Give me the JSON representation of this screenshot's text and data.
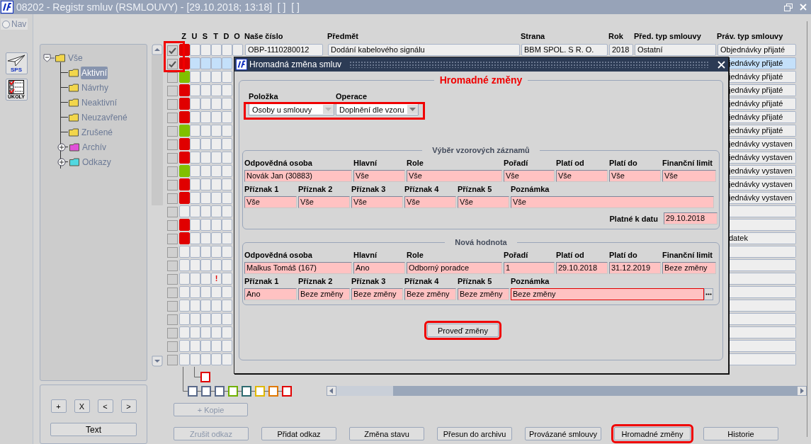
{
  "window": {
    "title": "08202 - Registr smluv (RSMLOUVY) - [29.10.2018; 13:18]  [ ]  [ ]"
  },
  "nav": {
    "label": "Nav",
    "selected": false
  },
  "launchers": [
    {
      "label": "SPS",
      "kind": "plane"
    },
    {
      "label": "ÚKOLY",
      "kind": "checklist"
    }
  ],
  "tree": [
    {
      "label": "Vše",
      "expanded": true,
      "selected": false,
      "color": "#f2d64b",
      "children": [
        {
          "label": "Aktivní",
          "selected": true,
          "color": "#f2d64b"
        },
        {
          "label": "Návrhy",
          "selected": false,
          "color": "#f2d64b"
        },
        {
          "label": "Neaktivní",
          "selected": false,
          "color": "#f2d64b"
        },
        {
          "label": "Neuzavřené",
          "selected": false,
          "color": "#f2d64b"
        },
        {
          "label": "Zrušené",
          "selected": false,
          "color": "#f2d64b"
        },
        {
          "label": "Archív",
          "selected": false,
          "expanded": false,
          "color": "#e050d8"
        },
        {
          "label": "Odkazy",
          "selected": false,
          "expanded": false,
          "color": "#50d8e0"
        }
      ]
    }
  ],
  "tree_buttons": [
    "+",
    "X",
    "<",
    ">"
  ],
  "text_button": "Text",
  "table": {
    "checkbox_highlight": true,
    "columns": [
      "Z",
      "U",
      "S",
      "T",
      "D",
      "O",
      "Naše číslo",
      "Předmět",
      "Strana",
      "Rok",
      "Před. typ smlouvy",
      "Práv. typ smlouvy"
    ],
    "rows": [
      {
        "kind": "full",
        "checked": true,
        "selected": false,
        "color": "#e00000",
        "cells": [
          "OBP-1110280012",
          "Dodání kabelového signálu",
          "BBM SPOL. S R. O.",
          "2018",
          "Ostatní",
          "Objednávky přijaté"
        ]
      },
      {
        "kind": "covered",
        "checked": true,
        "selected": true,
        "color": "#e00000",
        "tail": "jednávky přijaté"
      },
      {
        "kind": "covered",
        "checked": false,
        "selected": false,
        "color": "#80c000",
        "tail": "jednávky přijaté"
      },
      {
        "kind": "covered",
        "checked": false,
        "selected": false,
        "color": "#e00000",
        "tail": "jednávky přijaté"
      },
      {
        "kind": "covered",
        "checked": false,
        "selected": false,
        "color": "#e00000",
        "tail": "jednávky přijaté"
      },
      {
        "kind": "covered",
        "checked": false,
        "selected": false,
        "color": "#e00000",
        "tail": "jednávky přijaté"
      },
      {
        "kind": "covered",
        "checked": false,
        "selected": false,
        "color": "#80c000",
        "tail": "jednávky přijaté"
      },
      {
        "kind": "covered",
        "checked": false,
        "selected": false,
        "color": "#e00000",
        "tail": "jednávky vystaven"
      },
      {
        "kind": "covered",
        "checked": false,
        "selected": false,
        "color": "#e00000",
        "tail": "jednávky vystaven"
      },
      {
        "kind": "covered",
        "checked": false,
        "selected": false,
        "color": "#80c000",
        "tail": "jednávky vystaven"
      },
      {
        "kind": "covered",
        "checked": false,
        "selected": false,
        "color": "#e00000",
        "tail": "jednávky vystaven"
      },
      {
        "kind": "covered",
        "checked": false,
        "selected": false,
        "color": "#e00000",
        "tail": "jednávky vystaven"
      },
      {
        "kind": "covered",
        "checked": false,
        "selected": false
      },
      {
        "kind": "covered",
        "checked": false,
        "selected": false,
        "color": "#e00000"
      },
      {
        "kind": "covered",
        "checked": false,
        "selected": false,
        "color": "#e00000",
        "tail": "datek"
      },
      {
        "kind": "covered",
        "checked": false,
        "selected": false
      },
      {
        "kind": "covered",
        "checked": false,
        "selected": false
      },
      {
        "kind": "covered",
        "checked": false,
        "selected": false,
        "flag": "!"
      },
      {
        "kind": "covered",
        "checked": false,
        "selected": false
      },
      {
        "kind": "covered",
        "checked": false,
        "selected": false
      },
      {
        "kind": "covered",
        "checked": false,
        "selected": false
      },
      {
        "kind": "covered",
        "checked": false,
        "selected": false
      },
      {
        "kind": "covered",
        "checked": false,
        "selected": false
      },
      {
        "kind": "covered",
        "checked": false,
        "selected": false
      }
    ]
  },
  "link_legend": {
    "top": {
      "color": "#e00000"
    },
    "boxes": [
      {
        "color": "#5a6a8a"
      },
      {
        "color": "#5a6a8a"
      },
      {
        "color": "#5a6a8a"
      },
      {
        "color": "#70b000"
      },
      {
        "color": "#2e6b70"
      },
      {
        "color": "#e0b800"
      },
      {
        "color": "#e07800"
      },
      {
        "color": "#e00000"
      }
    ]
  },
  "copy_button": {
    "label": "+ Kopie",
    "disabled": true
  },
  "buttons": [
    {
      "label": "Zrušit odkaz",
      "disabled": true,
      "highlighted": false
    },
    {
      "label": "Přidat odkaz",
      "disabled": false,
      "highlighted": false
    },
    {
      "label": "Změna stavu",
      "disabled": false,
      "highlighted": false
    },
    {
      "label": "Přesun do archivu",
      "disabled": false,
      "highlighted": false
    },
    {
      "label": "Provázané smlouvy",
      "disabled": false,
      "highlighted": false
    },
    {
      "label": "Hromadné změny",
      "disabled": false,
      "highlighted": true
    },
    {
      "label": "Historie",
      "disabled": false,
      "highlighted": false
    }
  ],
  "dialog": {
    "title": "Hromadná změna smluv",
    "heading": "Hromadné změny",
    "selectors": {
      "highlighted": true,
      "items": [
        {
          "label": "Položka",
          "value": "Osoby u smlouvy"
        },
        {
          "label": "Operace",
          "value": "Doplnění dle vzoru"
        }
      ]
    },
    "sample": {
      "title": "Výběr vzorových záznamů",
      "row_a": [
        {
          "label": "Odpovědná osoba",
          "value": "Novák Jan (30883)"
        },
        {
          "label": "Hlavní",
          "value": "Vše"
        },
        {
          "label": "Role",
          "value": "Vše"
        },
        {
          "label": "Pořadí",
          "value": "Vše"
        },
        {
          "label": "Platí od",
          "value": "Vše"
        },
        {
          "label": "Platí do",
          "value": "Vše"
        },
        {
          "label": "Finanční limit",
          "value": "Vše"
        }
      ],
      "row_b": [
        {
          "label": "Příznak 1",
          "value": "Vše"
        },
        {
          "label": "Příznak 2",
          "value": "Vše"
        },
        {
          "label": "Příznak 3",
          "value": "Vše"
        },
        {
          "label": "Příznak 4",
          "value": "Vše"
        },
        {
          "label": "Příznak 5",
          "value": "Vše"
        },
        {
          "label": "Poznámka",
          "value": "Vše"
        }
      ],
      "date": {
        "label": "Platné k datu",
        "value": "29.10.2018"
      }
    },
    "new_value": {
      "title": "Nová hodnota",
      "row_a": [
        {
          "label": "Odpovědná osoba",
          "value": "Malkus Tomáš (167)"
        },
        {
          "label": "Hlavní",
          "value": "Ano"
        },
        {
          "label": "Role",
          "value": "Odborný poradce"
        },
        {
          "label": "Pořadí",
          "value": "1"
        },
        {
          "label": "Platí od",
          "value": "29.10.2018"
        },
        {
          "label": "Platí do",
          "value": "31.12.2019"
        },
        {
          "label": "Finanční limit",
          "value": "Beze změny"
        }
      ],
      "row_b": [
        {
          "label": "Příznak 1",
          "value": "Ano"
        },
        {
          "label": "Příznak 2",
          "value": "Beze změny"
        },
        {
          "label": "Příznak 3",
          "value": "Beze změny"
        },
        {
          "label": "Příznak 4",
          "value": "Beze změny"
        },
        {
          "label": "Příznak 5",
          "value": "Beze změny"
        },
        {
          "label": "Poznámka",
          "value": "Beze změny",
          "focused": true
        }
      ]
    },
    "apply_button": {
      "label": "Proveď změny",
      "highlighted": true
    }
  }
}
